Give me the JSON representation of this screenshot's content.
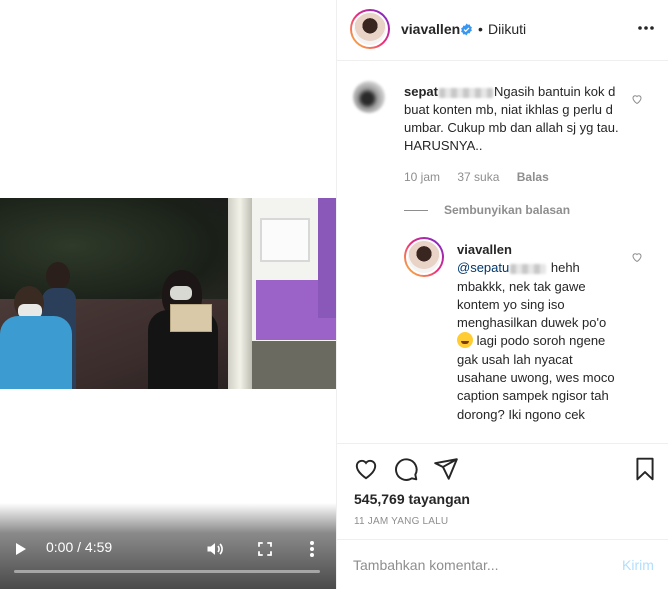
{
  "video": {
    "time": "0:00 / 4:59",
    "progress": 0.0,
    "icons": {
      "play": "play-icon",
      "volume": "volume-icon",
      "fullscreen": "fullscreen-icon",
      "more": "more-vertical-icon"
    }
  },
  "header": {
    "username": "viavallen",
    "separator": "•",
    "follow_status": "Diikuti",
    "verified": true,
    "icons": {
      "more": "more-horizontal-icon",
      "verified": "verified-badge-icon"
    }
  },
  "comment": {
    "username": "sepat",
    "text": "Ngasih bantuin kok d buat konten mb, niat ikhlas g perlu d umbar. Cukup mb dan allah sj yg tau. HARUSNYA..",
    "time": "10 jam",
    "likes": "37 suka",
    "reply_label": "Balas"
  },
  "hide_replies_label": "Sembunyikan balasan",
  "reply": {
    "username": "viavallen",
    "mention": "@sepatu",
    "text_before_emoji": "hehh mbakkk, nek tak gawe kontem yo sing iso menghasilkan duwek po'o",
    "text_after_emoji": "lagi podo soroh ngene gak usah lah nyacat usahane uwong, wes moco caption sampek ngisor tah dorong? Iki ngono cek"
  },
  "actions": {
    "views": "545,769 tayangan",
    "posted": "11 JAM YANG LALU",
    "icons": {
      "like": "heart-icon",
      "comment": "comment-icon",
      "share": "send-icon",
      "save": "bookmark-icon"
    }
  },
  "comment_box": {
    "placeholder": "Tambahkan komentar...",
    "post_label": "Kirim"
  },
  "colors": {
    "accent": "#0095f6",
    "post_disabled": "#b2dffc",
    "verified": "#3897f0",
    "muted": "#8e8e8e"
  }
}
